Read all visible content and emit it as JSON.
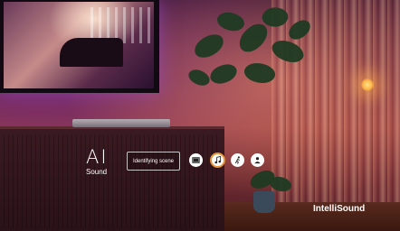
{
  "ai_panel": {
    "title": "AI",
    "subtitle": "Sound",
    "scene_label": "Identifying scene"
  },
  "modes": [
    {
      "icon": "movie-icon",
      "active": false
    },
    {
      "icon": "music-note-icon",
      "active": true
    },
    {
      "icon": "sports-icon",
      "active": false
    },
    {
      "icon": "voice-icon",
      "active": false
    }
  ],
  "brand": "IntelliSound",
  "colors": {
    "accent": "#e8943a",
    "wave_left": "#ff4a8a",
    "wave_right": "#4a7aff"
  }
}
